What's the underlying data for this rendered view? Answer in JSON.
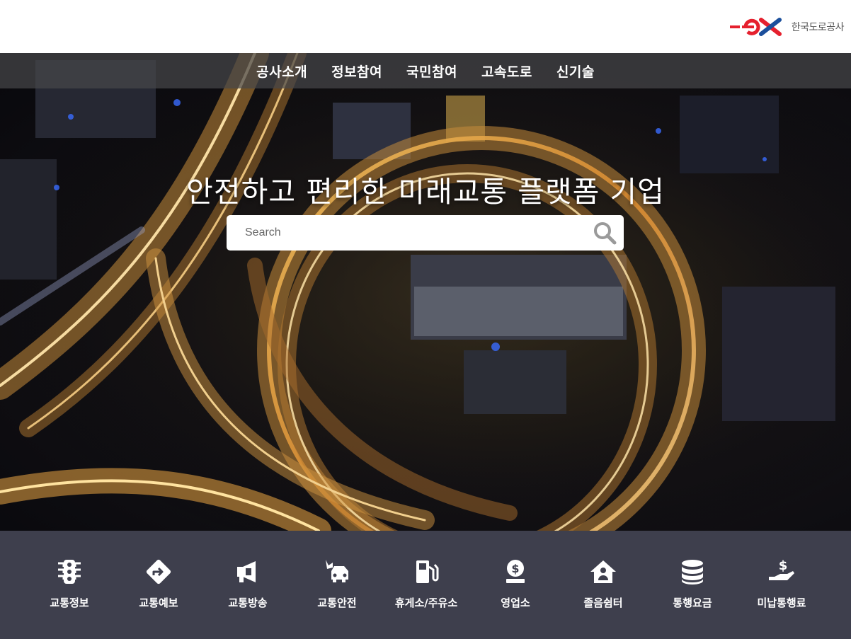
{
  "header": {
    "logo_mark": "ex",
    "logo_text": "한국도로공사",
    "brand_color": "#e5202e",
    "brand_blue": "#1b4f9c"
  },
  "nav": {
    "items": [
      {
        "label": "공사소개"
      },
      {
        "label": "정보참여"
      },
      {
        "label": "국민참여"
      },
      {
        "label": "고속도로"
      },
      {
        "label": "신기술"
      }
    ]
  },
  "hero": {
    "headline": "안전하고 편리한 미래교통 플랫폼 기업",
    "search": {
      "placeholder": "Search",
      "value": "",
      "icon": "search-icon"
    }
  },
  "quick_menu": {
    "items": [
      {
        "label": "교통정보",
        "icon": "traffic-light-icon"
      },
      {
        "label": "교통예보",
        "icon": "directions-sign-icon"
      },
      {
        "label": "교통방송",
        "icon": "megaphone-icon"
      },
      {
        "label": "교통안전",
        "icon": "car-crash-icon"
      },
      {
        "label": "휴게소/주유소",
        "icon": "gas-pump-icon"
      },
      {
        "label": "영업소",
        "icon": "coin-stack-icon"
      },
      {
        "label": "졸음쉼터",
        "icon": "rest-house-icon"
      },
      {
        "label": "통행요금",
        "icon": "database-icon"
      },
      {
        "label": "미납통행료",
        "icon": "hand-dollar-icon"
      }
    ]
  }
}
